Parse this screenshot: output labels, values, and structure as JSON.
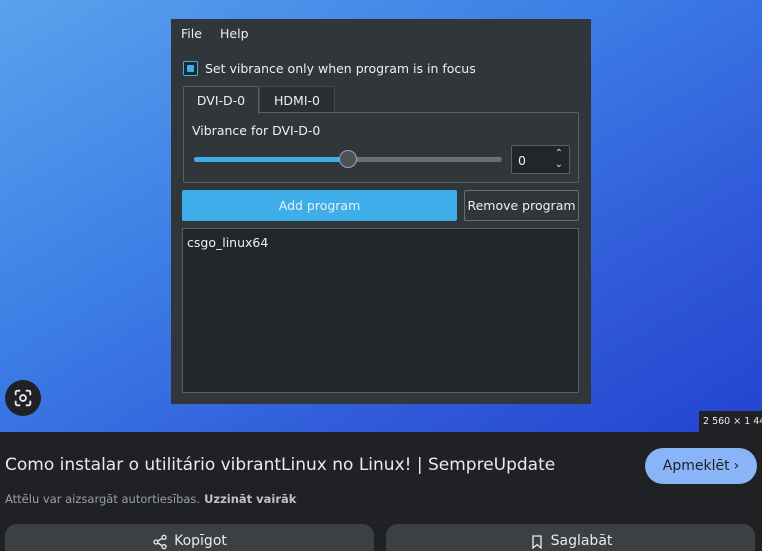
{
  "app": {
    "menu": [
      "File",
      "Help"
    ],
    "checkbox_label": "Set vibrance only when program is in focus",
    "checkbox_checked": true,
    "tabs": [
      "DVI-D-0",
      "HDMI-0"
    ],
    "active_tab": "DVI-D-0",
    "vibrance_label": "Vibrance for DVI-D-0",
    "slider_level": 0.5,
    "spin_value": "0",
    "add_button": "Add program",
    "remove_button": "Remove program",
    "programs": [
      "csgo_linux64"
    ]
  },
  "viewer": {
    "size_badge": "2 560 × 1 44",
    "title": "Como instalar o utilitário vibrantLinux no Linux! | SempreUpdate",
    "visit_label": "Apmeklēt",
    "copyright_text": "Attēlu var aizsargāt autortiesības.",
    "learn_more": "Uzzināt vairāk",
    "share_label": "Kopīgot",
    "save_label": "Saglabāt"
  },
  "colors": {
    "accent": "#3daee9",
    "window_bg": "#31363b",
    "visit_button": "#8ab4f8",
    "page_bg": "#202124"
  },
  "icons": [
    "lens-icon",
    "share-icon",
    "bookmark-icon",
    "chevron-right-icon",
    "spin-up-icon",
    "spin-down-icon"
  ]
}
